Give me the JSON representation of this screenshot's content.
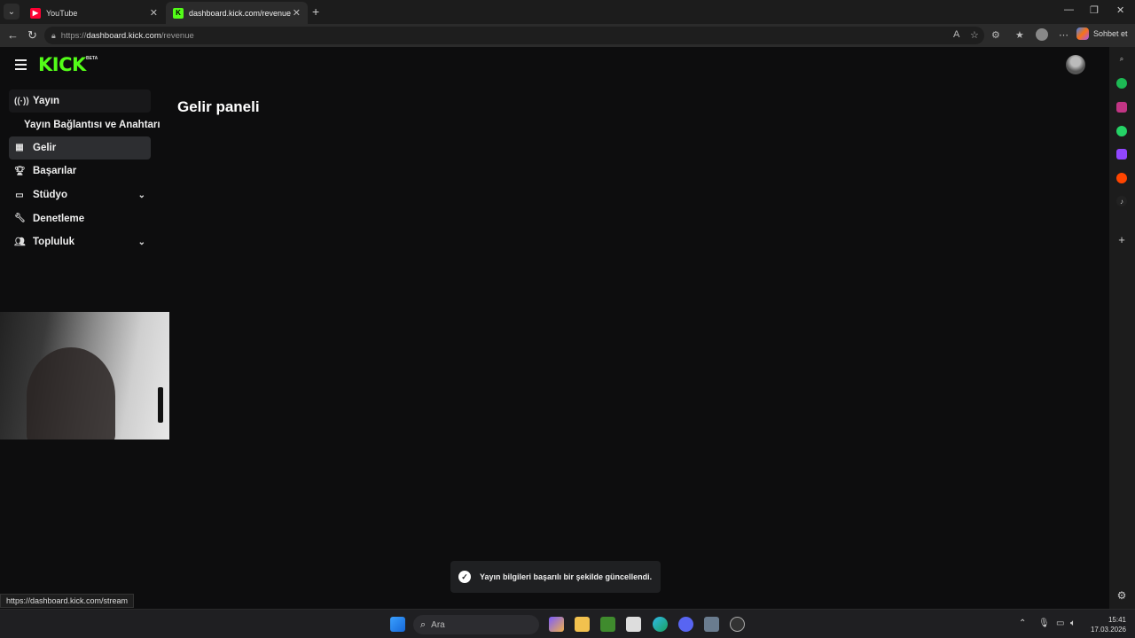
{
  "browser": {
    "tabs": [
      {
        "title": "YouTube",
        "icon": "youtube-icon",
        "active": false
      },
      {
        "title": "dashboard.kick.com/revenue",
        "icon": "kick-icon",
        "active": true
      }
    ],
    "url_scheme": "https://",
    "url_host": "dashboard.kick.com",
    "url_path": "/revenue",
    "copilot_label": "Sohbet et"
  },
  "kick": {
    "logo": "KICK",
    "beta": "BETA",
    "brand_color": "#53fc18"
  },
  "sidebar": {
    "items": [
      {
        "label": "Yayın",
        "icon": "broadcast-icon"
      },
      {
        "label": "Yayın Bağlantısı ve Anahtarı",
        "sub": true
      },
      {
        "label": "Gelir",
        "icon": "chart-icon",
        "active": true
      },
      {
        "label": "Başarılar",
        "icon": "trophy-icon"
      },
      {
        "label": "Stüdyo",
        "icon": "studio-icon",
        "expandable": true
      },
      {
        "label": "Denetleme",
        "icon": "wrench-icon"
      },
      {
        "label": "Topluluk",
        "icon": "community-icon",
        "expandable": true
      }
    ]
  },
  "main": {
    "title": "Gelir paneli"
  },
  "toast": {
    "message": "Yayın bilgileri başarılı bir şekilde güncellendi."
  },
  "status_url": "https://dashboard.kick.com/stream",
  "taskbar": {
    "search_placeholder": "Ara",
    "time": "15:41",
    "date": "17.03.2026"
  }
}
